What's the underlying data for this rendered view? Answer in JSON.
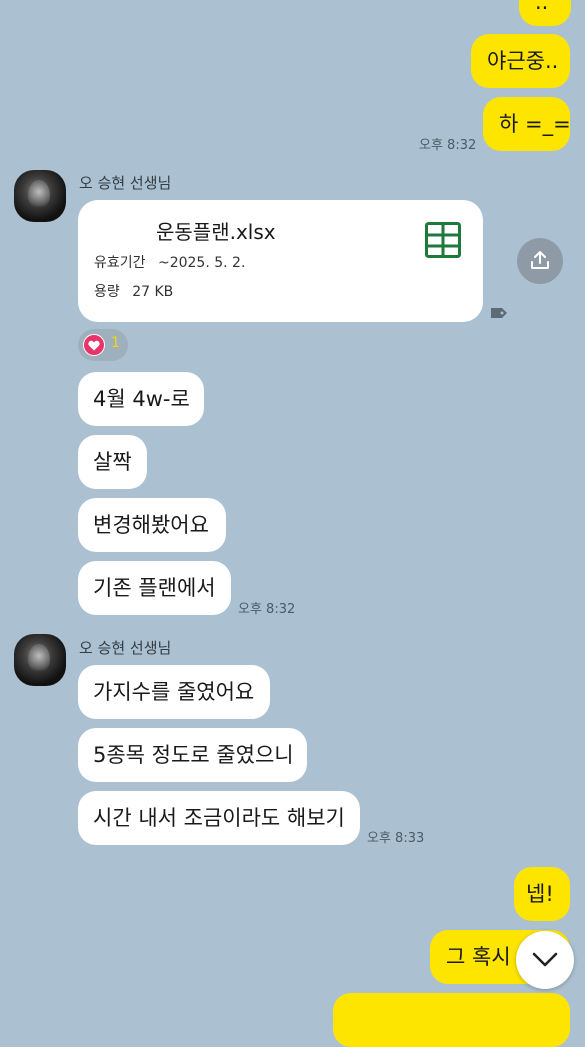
{
  "colors": {
    "background": "#abc1d1",
    "outgoing_bubble": "#fee500",
    "incoming_bubble": "#ffffff",
    "excel_green": "#1e7a3c",
    "reaction_heart": "#e8336b"
  },
  "outgoing_top": [
    {
      "text": "..",
      "time": ""
    },
    {
      "text": "야근중..",
      "time": ""
    },
    {
      "text": "하 =_=",
      "time": "오후 8:32"
    }
  ],
  "sender_group_1": {
    "sender": "오 승현 선생님",
    "file": {
      "name": "운동플랜.xlsx",
      "validity_label": "유효기간",
      "validity_value": "~2025. 5. 2.",
      "size_label": "용량",
      "size_value": "27 KB",
      "icon": "spreadsheet-icon"
    },
    "reaction": {
      "icon": "heart-icon",
      "count": "1"
    },
    "messages": [
      "4월 4w-로",
      "살짝",
      "변경해봤어요",
      "기존 플랜에서"
    ],
    "time": "오후 8:32"
  },
  "sender_group_2": {
    "sender": "오 승현 선생님",
    "messages": [
      "가지수를 줄였어요",
      "5종목 정도로 줄였으니",
      "시간 내서 조금이라도 해보기"
    ],
    "time": "오후 8:33"
  },
  "outgoing_bottom": [
    {
      "text": "넵!"
    },
    {
      "text": "그 혹시"
    }
  ],
  "icons": {
    "share": "share-upload-icon",
    "tag": "tag-icon",
    "scroll": "chevron-down-icon"
  }
}
